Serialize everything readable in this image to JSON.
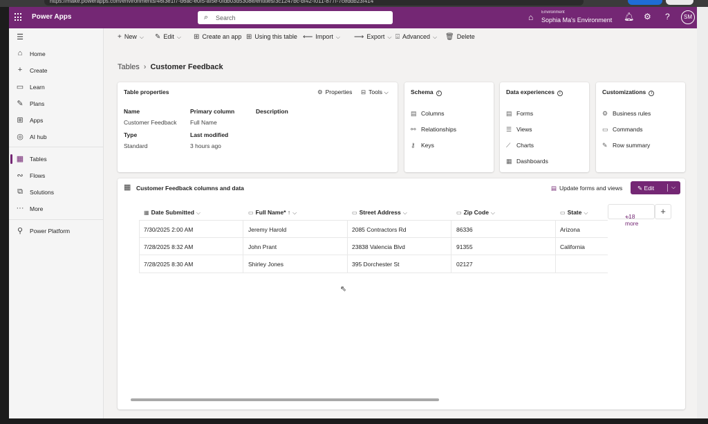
{
  "browser": {
    "url": "https://make.powerapps.com/environments/46f3e1f7-d6ac-e0f5-af5e-0fdb03d5308e/entities/3c1247bc-bf42-f011-877f-7ceddb23f414"
  },
  "topbar": {
    "brand": "Power Apps",
    "search_placeholder": "Search",
    "environment_label": "Environment",
    "environment_name": "Sophia Ma's Environment",
    "avatar_initials": "SM",
    "color": "#742774"
  },
  "sidebar": {
    "items": [
      {
        "label": "Home",
        "icon": "home-icon"
      },
      {
        "label": "Create",
        "icon": "plus-icon"
      },
      {
        "label": "Learn",
        "icon": "book-icon"
      },
      {
        "label": "Plans",
        "icon": "plans-icon"
      },
      {
        "label": "Apps",
        "icon": "apps-icon"
      },
      {
        "label": "AI hub",
        "icon": "ai-hub-icon"
      },
      {
        "label": "Tables",
        "icon": "table-icon",
        "active": true
      },
      {
        "label": "Flows",
        "icon": "flow-icon"
      },
      {
        "label": "Solutions",
        "icon": "solutions-icon"
      },
      {
        "label": "More",
        "icon": "ellipsis-icon"
      },
      {
        "label": "Power Platform",
        "icon": "power-platform-icon"
      }
    ]
  },
  "commandbar": {
    "new": "New",
    "edit": "Edit",
    "create_app": "Create an app",
    "using_table": "Using this table",
    "import": "Import",
    "export": "Export",
    "advanced": "Advanced",
    "delete": "Delete"
  },
  "breadcrumb": {
    "root": "Tables",
    "current": "Customer Feedback"
  },
  "table_properties": {
    "title": "Table properties",
    "properties_btn": "Properties",
    "tools_btn": "Tools",
    "name_label": "Name",
    "name_value": "Customer Feedback",
    "primary_label": "Primary column",
    "primary_value": "Full Name",
    "description_label": "Description",
    "type_label": "Type",
    "type_value": "Standard",
    "modified_label": "Last modified",
    "modified_value": "3 hours ago"
  },
  "schema": {
    "title": "Schema",
    "items": [
      "Columns",
      "Relationships",
      "Keys"
    ]
  },
  "data_experiences": {
    "title": "Data experiences",
    "items": [
      "Forms",
      "Views",
      "Charts",
      "Dashboards"
    ]
  },
  "customizations": {
    "title": "Customizations",
    "items": [
      "Business rules",
      "Commands",
      "Row summary"
    ]
  },
  "grid": {
    "title": "Customer Feedback columns and data",
    "update_btn": "Update forms and views",
    "edit_btn": "Edit",
    "more_columns": "+18 more",
    "headers": [
      {
        "label": "Date Submitted",
        "required": "",
        "sort": ""
      },
      {
        "label": "Full Name",
        "required": "*",
        "sort": "↑"
      },
      {
        "label": "Street Address",
        "required": "",
        "sort": ""
      },
      {
        "label": "Zip Code",
        "required": "",
        "sort": ""
      },
      {
        "label": "State",
        "required": "",
        "sort": ""
      }
    ],
    "rows": [
      [
        "7/30/2025 2:00 AM",
        "Jeremy Harold",
        "2085 Contractors Rd",
        "86336",
        "Arizona"
      ],
      [
        "7/28/2025 8:32 AM",
        "John Prant",
        "23838 Valencia Blvd",
        "91355",
        "California"
      ],
      [
        "7/28/2025 8:30 AM",
        "Shirley Jones",
        "395 Dorchester St",
        "02127",
        ""
      ]
    ]
  }
}
